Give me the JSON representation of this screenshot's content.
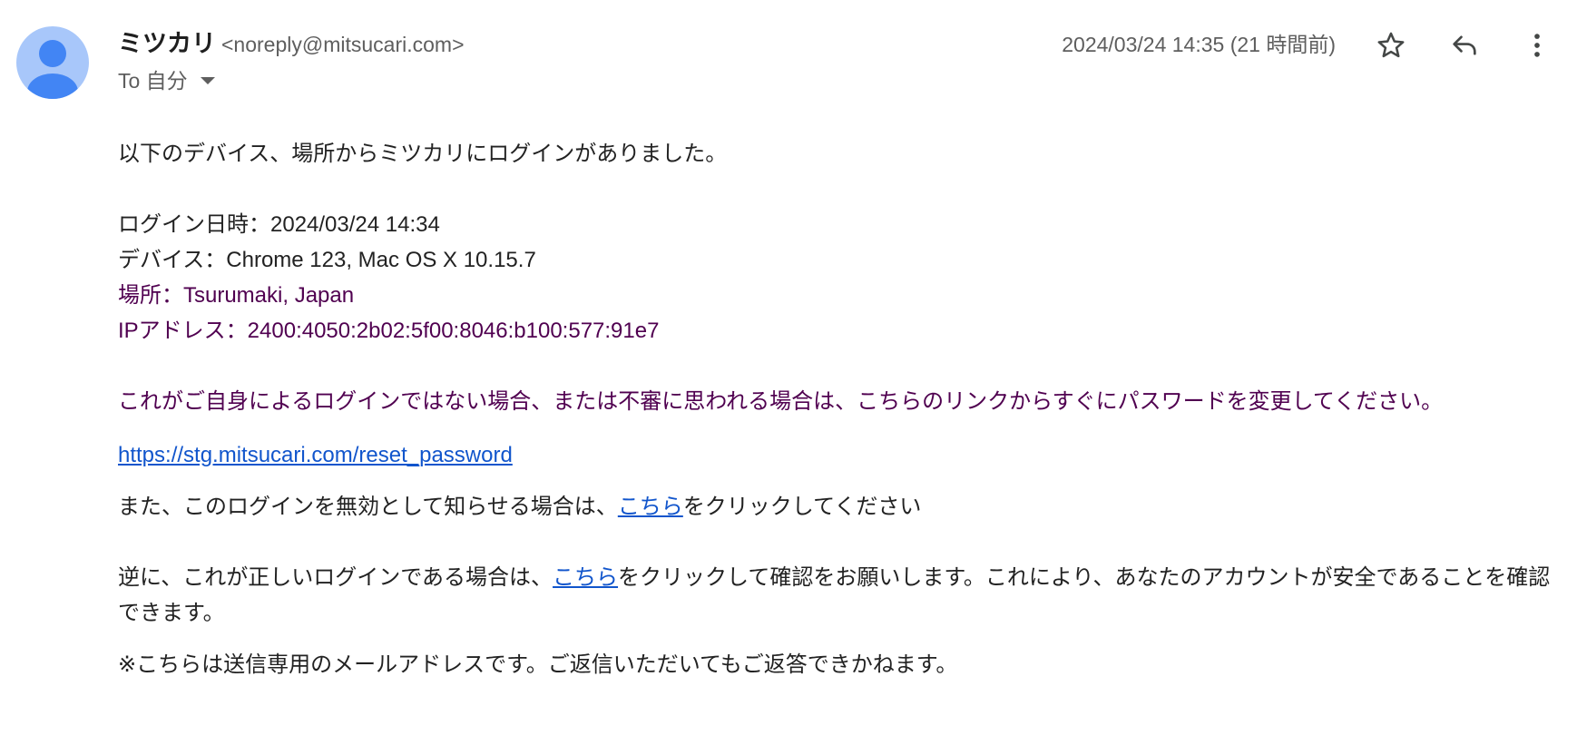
{
  "header": {
    "sender_name": "ミツカリ",
    "sender_email": "<noreply@mitsucari.com>",
    "recipient_label": "To 自分",
    "date": "2024/03/24 14:35 (21 時間前)"
  },
  "icons": {
    "avatar": "person-avatar-icon",
    "star": "star-outline-icon",
    "reply": "reply-icon",
    "more": "more-vert-icon",
    "recipient_dropdown": "caret-down-icon"
  },
  "colors": {
    "avatar_bg": "#a8c7fa",
    "avatar_fg": "#4285f4",
    "link": "#1155cc",
    "quoted_text": "#500050"
  },
  "body": {
    "intro": "以下のデバイス、場所からミツカリにログインがありました。",
    "login_time": "ログイン日時：2024/03/24 14:34",
    "device": "デバイス：Chrome 123, Mac OS X 10.15.7",
    "location": "場所：Tsurumaki, Japan",
    "ip": "IPアドレス：2400:4050:2b02:5f00:8046:b100:577:91e7",
    "warning": "これがご自身によるログインではない場合、または不審に思われる場合は、こちらのリンクからすぐにパスワードを変更してください。",
    "reset_link": "https://stg.mitsucari.com/reset_password",
    "invalidate_before": "また、このログインを無効として知らせる場合は、",
    "invalidate_link": "こちら",
    "invalidate_after": "をクリックしてください",
    "confirm_before": "逆に、これが正しいログインである場合は、",
    "confirm_link": "こちら",
    "confirm_after": "をクリックして確認をお願いします。これにより、あなたのアカウントが安全であることを確認できます。",
    "footer_note": "※こちらは送信専用のメールアドレスです。ご返信いただいてもご返答できかねます。"
  }
}
